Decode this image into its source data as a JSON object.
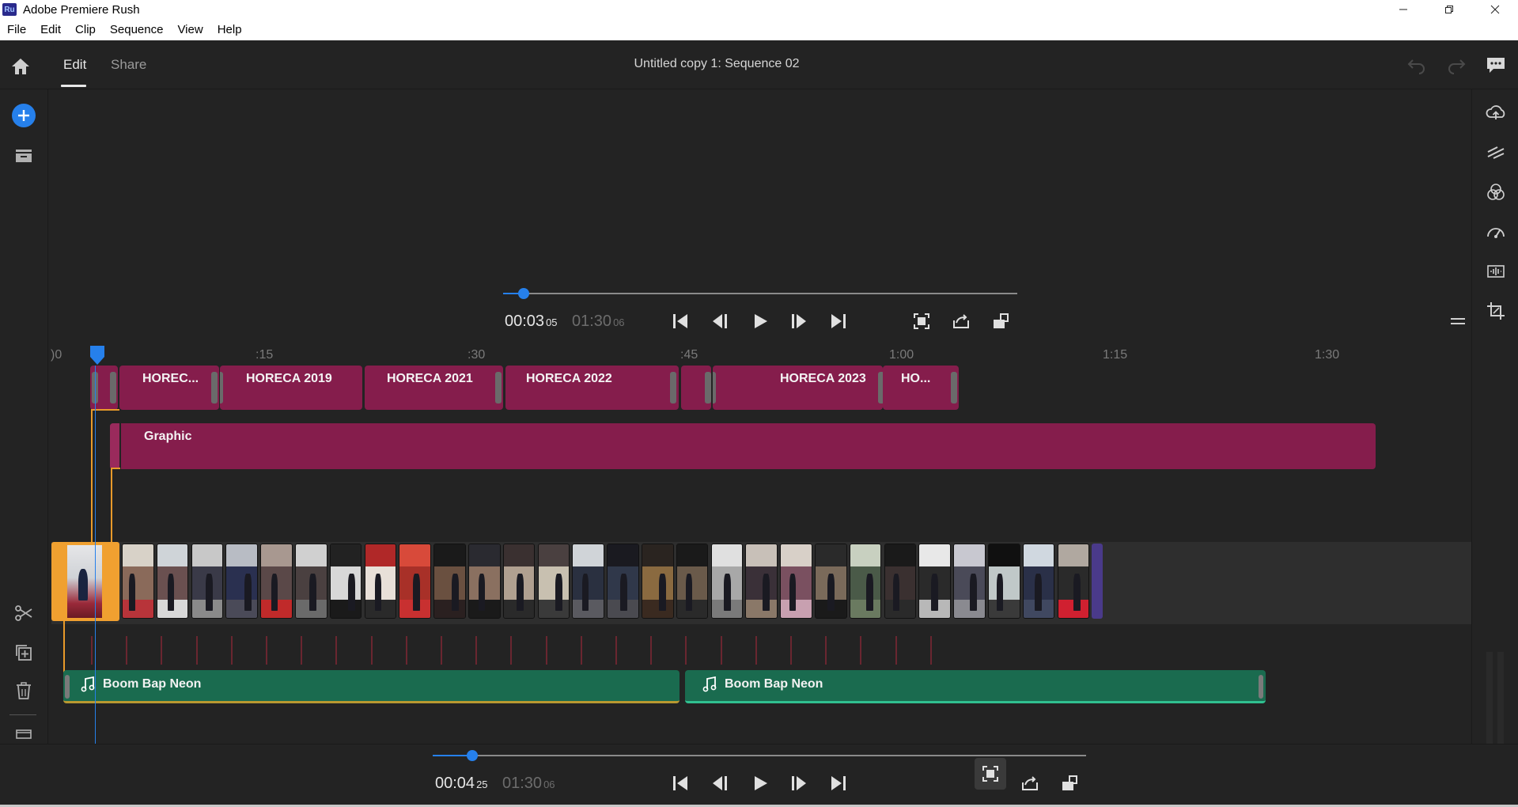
{
  "window": {
    "logo_text": "Ru",
    "title": "Adobe Premiere Rush",
    "minimize_label": "─",
    "maximize_label": "❐",
    "close_label": "✕"
  },
  "menu": [
    "File",
    "Edit",
    "Clip",
    "Sequence",
    "View",
    "Help"
  ],
  "header": {
    "tabs": [
      {
        "label": "Edit",
        "active": true
      },
      {
        "label": "Share",
        "active": false
      }
    ],
    "sequence_title": "Untitled copy 1: Sequence 02"
  },
  "preview_player": {
    "current_time": "00:03",
    "current_frames": "05",
    "total_time": "01:30",
    "total_frames": "06",
    "playhead_fraction": 0.04
  },
  "ruler": {
    "labels": [
      ")0",
      ":15",
      ":30",
      ":45",
      "1:00",
      "1:15",
      "1:30"
    ]
  },
  "timeline": {
    "title_clips": [
      {
        "label": ""
      },
      {
        "label": "HOREC..."
      },
      {
        "label": "HORECA 2019"
      },
      {
        "label": "HORECA 2021"
      },
      {
        "label": "HORECA 2022"
      },
      {
        "label": ""
      },
      {
        "label": "HORECA 2023"
      },
      {
        "label": "HO..."
      }
    ],
    "graphic_clip": {
      "label": "Graphic"
    },
    "audio_clips": [
      {
        "label": "Boom Bap Neon"
      },
      {
        "label": "Boom Bap Neon"
      }
    ]
  },
  "bottom_player": {
    "current_time": "00:04",
    "current_frames": "25",
    "total_time": "01:30",
    "total_frames": "06",
    "playhead_fraction": 0.06
  },
  "colors": {
    "accent": "#2680eb",
    "title_clip": "#851d4c",
    "audio_clip": "#1a6b4f",
    "selected_clip": "#f0a030"
  }
}
